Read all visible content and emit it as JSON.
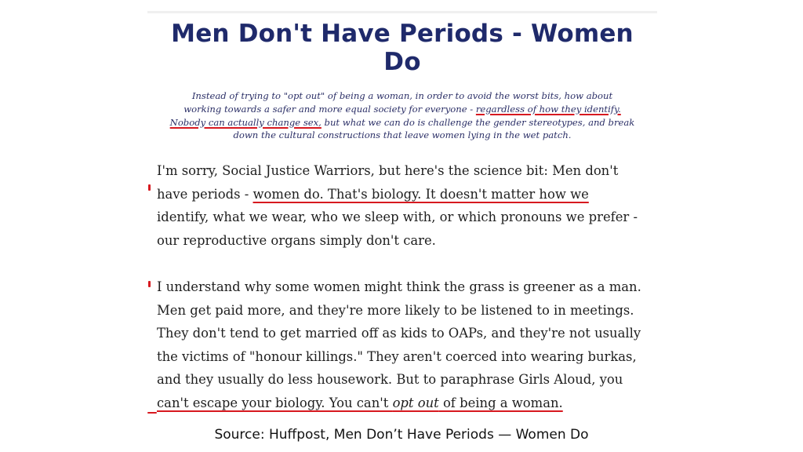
{
  "headline": {
    "line1": "Men Don't Have Periods - Women",
    "line2": "Do"
  },
  "standfirst": {
    "l1": "Instead of trying to \"opt out\" of being a woman, in order to avoid the worst bits, how about",
    "l2a": "working towards a safer and more equal society for everyone - ",
    "l2b": "regardless of how they identify.",
    "l3a": "Nobody can actually change sex,",
    "l3b": " but what we can do is challenge the gender stereotypes, and break",
    "l4": "down the cultural constructions that leave women lying in the wet patch."
  },
  "body": {
    "p1": {
      "l1": "I'm sorry, Social Justice Warriors, but here's the science bit: Men don't",
      "l2a": "have periods - ",
      "l2b": "women do. That's biology. It doesn't matter how we",
      "l3": "identify, what we wear, who we sleep with, or which pronouns we prefer -",
      "l4": "our reproductive organs simply don't care."
    },
    "p2": {
      "l1": "I understand why some women might think the grass is greener as a man.",
      "l2": "Men get paid more, and they're more likely to be listened to in meetings.",
      "l3": "They don't tend to get married off as kids to OAPs, and they're not usually",
      "l4": "the victims of \"honour killings.\" They aren't coerced into wearing burkas,",
      "l5": "and they usually do less housework. But to paraphrase Girls Aloud, you",
      "l6a": "can't escape your biology. You can't ",
      "l6b": "opt out",
      "l6c": " of being a woman."
    }
  },
  "caption": "Source: Huffpost, Men Don’t Have Periods — Women Do",
  "colors": {
    "headline": "#1f2a6b",
    "annotation_red": "#d71920",
    "body_text": "#1e1e1e"
  }
}
